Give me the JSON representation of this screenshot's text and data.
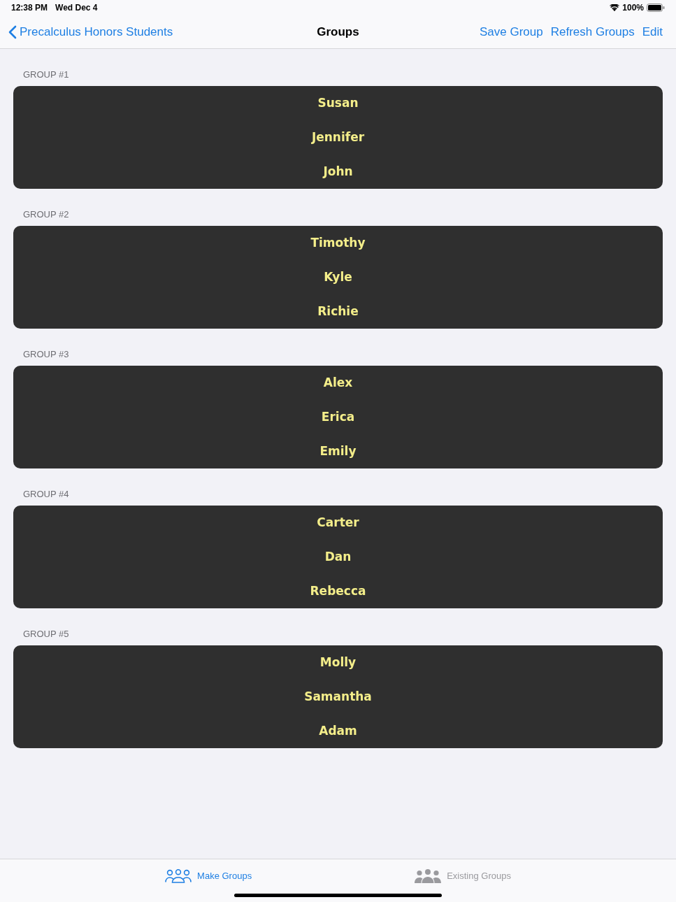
{
  "status_bar": {
    "time": "12:38 PM",
    "date": "Wed Dec 4",
    "battery": "100%"
  },
  "nav_bar": {
    "back": "Precalculus Honors Students",
    "title": "Groups",
    "buttons": [
      "Save Group",
      "Refresh Groups",
      "Edit"
    ]
  },
  "groups": [
    {
      "header": "GROUP #1",
      "members": [
        "Susan",
        "Jennifer",
        "John"
      ]
    },
    {
      "header": "GROUP #2",
      "members": [
        "Timothy",
        "Kyle",
        "Richie"
      ]
    },
    {
      "header": "GROUP #3",
      "members": [
        "Alex",
        "Erica",
        "Emily"
      ]
    },
    {
      "header": "GROUP #4",
      "members": [
        "Carter",
        "Dan",
        "Rebecca"
      ]
    },
    {
      "header": "GROUP #5",
      "members": [
        "Molly",
        "Samantha",
        "Adam"
      ]
    }
  ],
  "tab_bar": [
    {
      "label": "Make Groups",
      "selected": true
    },
    {
      "label": "Existing Groups",
      "selected": false
    }
  ]
}
